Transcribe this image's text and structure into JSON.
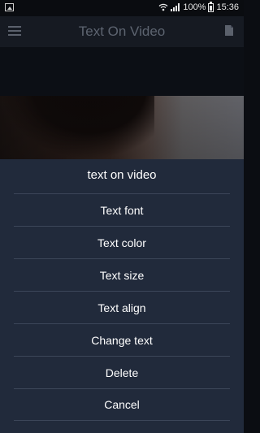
{
  "status_bar": {
    "battery_text": "100%",
    "time": "15:36",
    "icons": [
      "image-icon",
      "wifi-icon",
      "signal-icon",
      "battery-icon"
    ]
  },
  "toolbar": {
    "title": "Text On Video",
    "left_icon": "menu-icon",
    "right_icon": "file-icon"
  },
  "sheet": {
    "title": "text on video",
    "items": [
      {
        "label": "Text font"
      },
      {
        "label": "Text color"
      },
      {
        "label": "Text size"
      },
      {
        "label": "Text align"
      },
      {
        "label": "Change text"
      },
      {
        "label": "Delete"
      },
      {
        "label": "Cancel"
      }
    ]
  },
  "colors": {
    "sheet_background": "#212a3b",
    "divider": "#3c4659",
    "toolbar_background": "#161a22",
    "text": "#ffffff"
  }
}
